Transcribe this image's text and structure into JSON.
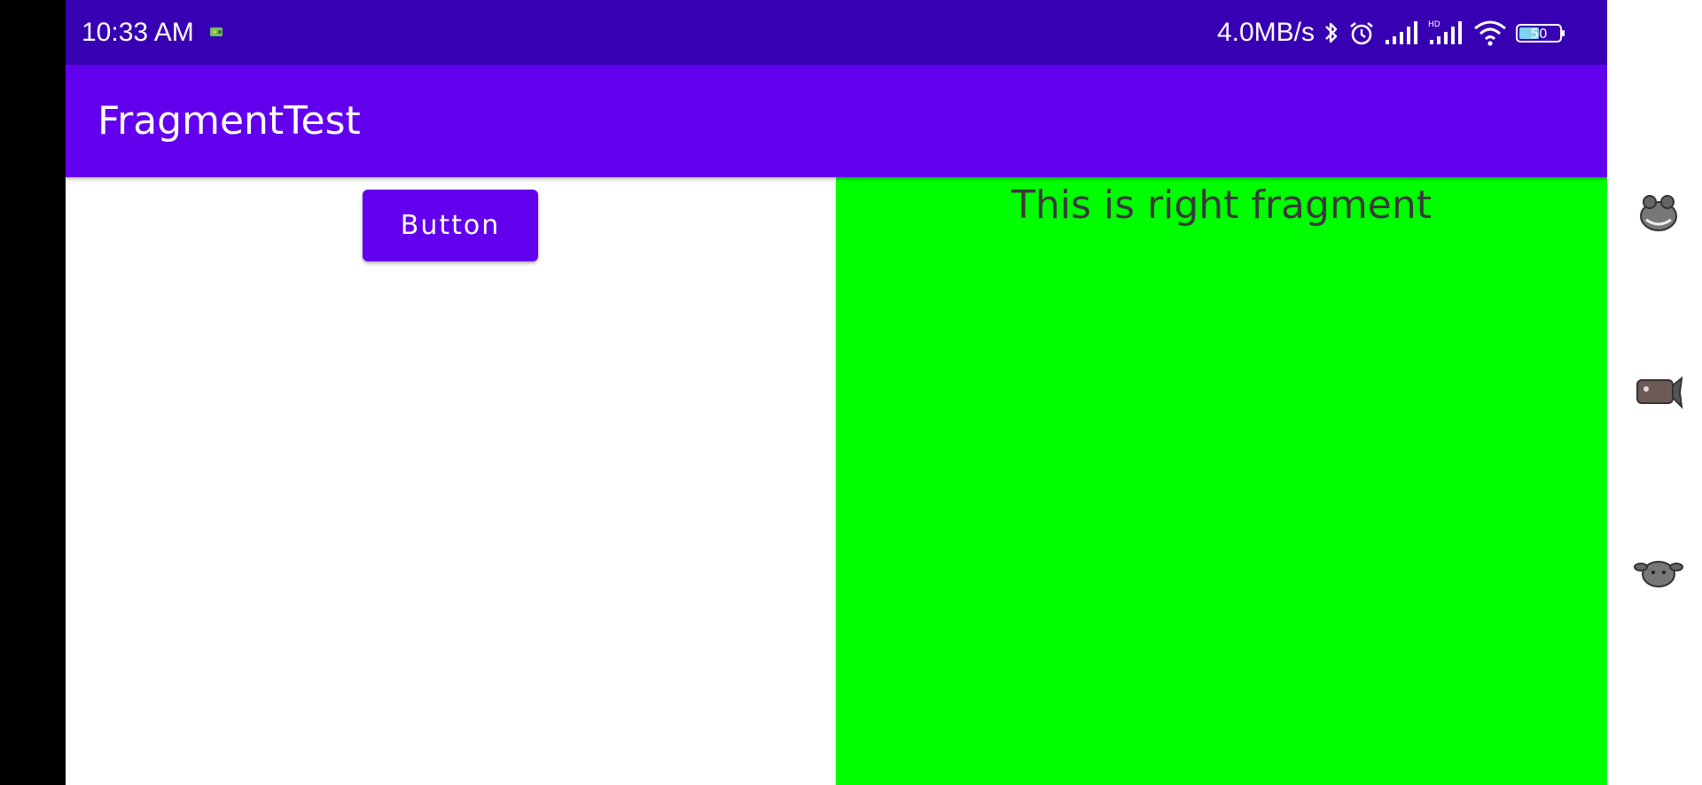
{
  "status_bar": {
    "time": "10:33 AM",
    "net_speed": "4.0MB/s",
    "battery_level": "50",
    "icons": [
      "app-notification-icon",
      "bluetooth-icon",
      "alarm-icon",
      "cell-signal-icon",
      "hd-signal-icon",
      "wifi-icon",
      "battery-icon"
    ],
    "color": "#3700b3"
  },
  "app_bar": {
    "title": "FragmentTest",
    "color": "#6200ee"
  },
  "left_fragment": {
    "button_label": "Button",
    "button_color": "#6200ee"
  },
  "right_fragment": {
    "text": "This is right fragment",
    "background": "#00ff00"
  },
  "side_panel": {
    "stickers": [
      "frog-sticker-icon",
      "fish-sticker-icon",
      "dog-sticker-icon"
    ]
  }
}
